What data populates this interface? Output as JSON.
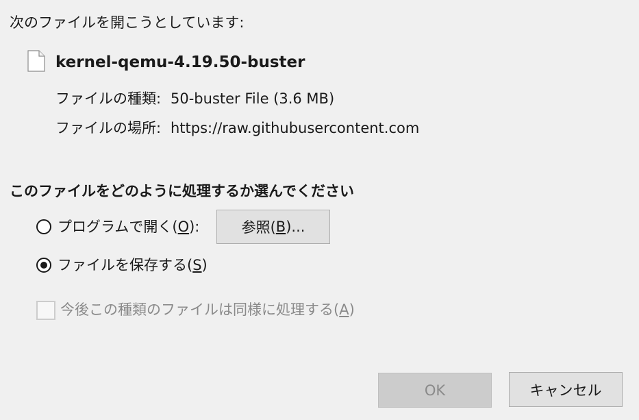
{
  "dialog": {
    "intro": "次のファイルを開こうとしています:",
    "file": {
      "icon": "file-icon",
      "name": "kernel-qemu-4.19.50-buster"
    },
    "type_label": "ファイルの種類:",
    "type_value": "50-buster File (3.6 MB)",
    "source_label": "ファイルの場所:",
    "source_value": "https://raw.githubusercontent.com",
    "question": "このファイルをどのように処理するか選んでください",
    "open_with": {
      "label_prefix": "プログラムで開く(",
      "accesskey": "O",
      "label_suffix": "):",
      "selected": false
    },
    "browse": {
      "label_prefix": "参照(",
      "accesskey": "B",
      "label_suffix": ")..."
    },
    "save_file": {
      "label_prefix": "ファイルを保存する(",
      "accesskey": "S",
      "label_suffix": ")",
      "selected": true
    },
    "remember": {
      "label_prefix": "今後この種類のファイルは同様に処理する(",
      "accesskey": "A",
      "label_suffix": ")",
      "checked": false,
      "disabled": true
    },
    "ok_label": "OK",
    "cancel_label": "キャンセル"
  }
}
